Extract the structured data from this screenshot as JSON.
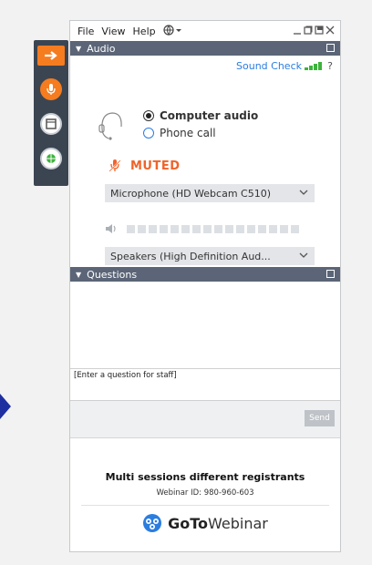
{
  "menubar": {
    "items": [
      "File",
      "View",
      "Help"
    ]
  },
  "audio": {
    "header": "Audio",
    "sound_check": "Sound Check",
    "help": "?",
    "options": [
      "Computer audio",
      "Phone call"
    ],
    "selected_option": "Computer audio",
    "status": "MUTED",
    "microphone": "Microphone (HD Webcam C510)",
    "speakers": "Speakers (High Definition Aud..."
  },
  "questions": {
    "header": "Questions",
    "input_placeholder": "[Enter a question for staff]",
    "send_label": "Send"
  },
  "footer": {
    "session_title": "Multi sessions different registrants",
    "webinar_id": "Webinar ID: 980-960-603",
    "brand_bold": "GoTo",
    "brand_regular": "Webinar"
  },
  "colors": {
    "accent_orange": "#f57c1f",
    "muted_red": "#f0632a",
    "header_gray": "#5b6577",
    "link_blue": "#2b7de0",
    "signal_green": "#3db33d"
  }
}
